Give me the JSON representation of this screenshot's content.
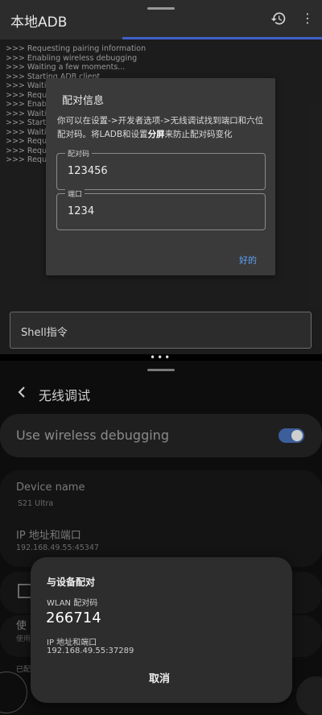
{
  "app": {
    "title": "本地ADB",
    "history_icon": "history-icon",
    "menu_icon": "more-vert-icon",
    "progress": 0.62
  },
  "log": [
    ">>> Requesting pairing information",
    ">>> Enabling wireless debugging",
    ">>> Waiting a few moments...",
    ">>> Starting ADB client",
    ">>> Waiting",
    ">>> Reques",
    ">>> Enablin",
    ">>> Waiting",
    ">>> Startin",
    ">>> Waiting",
    ">>> Reques",
    ">>> Reques",
    ">>> Reques"
  ],
  "pair_dialog": {
    "title": "配对信息",
    "message_pre": "你可以在设置->开发者选项->无线调试找到端口和六位配对码。将LADB和设置",
    "message_bold": "分屏",
    "message_post": "来防止配对码变化",
    "code_label": "配对码",
    "code_value": "123456",
    "port_label": "端口",
    "port_value": "1234",
    "ok_label": "好的"
  },
  "shell": {
    "placeholder": "Shell指令"
  },
  "settings": {
    "title": "无线调试",
    "use_wireless_label": "Use wireless debugging",
    "toggle_on": true,
    "device_name_label": "Device name",
    "device_name_value": "S21 Ultra",
    "ip_label": "IP 地址和端口",
    "ip_value": "192.168.49.55:45347",
    "cut_item_label": "使",
    "cut_item_sub": "使用",
    "cut_footer": "已配"
  },
  "wlan_dialog": {
    "title": "与设备配对",
    "code_label": "WLAN 配对码",
    "code_value": "266714",
    "ip_label": "IP 地址和端口",
    "ip_value": "192.168.49.55:37289",
    "cancel_label": "取消"
  },
  "colors": {
    "accent": "#3f61c9",
    "link": "#5ba3f5",
    "toggle": "#3c5f9c"
  }
}
